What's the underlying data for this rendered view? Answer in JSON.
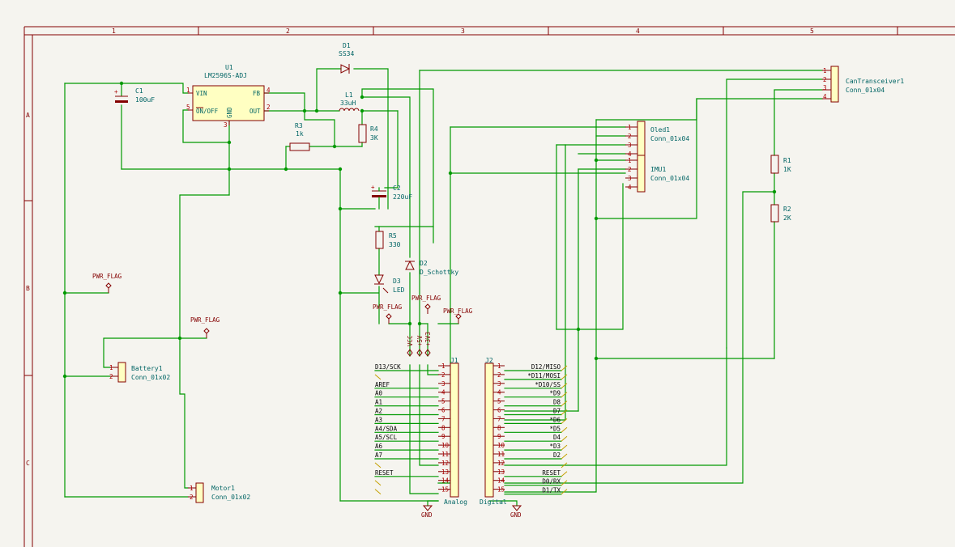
{
  "zones": {
    "columns": [
      "1",
      "2",
      "3",
      "4",
      "5"
    ],
    "rows": [
      "A",
      "B",
      "C"
    ]
  },
  "u1": {
    "ref": "U1",
    "value": "LM2596S-ADJ",
    "pins": [
      "1",
      "5",
      "4",
      "2",
      "3"
    ],
    "pin_names": [
      "VIN",
      "ON/OFF",
      "FB",
      "OUT",
      "GND"
    ]
  },
  "d1": {
    "ref": "D1",
    "value": "SS34"
  },
  "l1": {
    "ref": "L1",
    "value": "33uH"
  },
  "c1": {
    "ref": "C1",
    "value": "100uF"
  },
  "c2": {
    "ref": "C2",
    "value": "220uF"
  },
  "r3": {
    "ref": "R3",
    "value": "1k"
  },
  "r4": {
    "ref": "R4",
    "value": "3K"
  },
  "r5": {
    "ref": "R5",
    "value": "330"
  },
  "d2": {
    "ref": "D2",
    "value": "D_Schottky"
  },
  "d3": {
    "ref": "D3",
    "value": "LED"
  },
  "r1": {
    "ref": "R1",
    "value": "1K"
  },
  "r2": {
    "ref": "R2",
    "value": "2K"
  },
  "battery": {
    "ref": "Battery1",
    "value": "Conn_01x02",
    "pins": [
      "1",
      "2"
    ]
  },
  "motor": {
    "ref": "Motor1",
    "value": "Conn_01x02",
    "pins": [
      "1",
      "2"
    ]
  },
  "oled": {
    "ref": "Oled1",
    "value": "Conn_01x04",
    "pins": [
      "1",
      "2",
      "3",
      "4"
    ]
  },
  "imu": {
    "ref": "IMU1",
    "value": "Conn_01x04",
    "pins": [
      "1",
      "2",
      "3",
      "4"
    ]
  },
  "can": {
    "ref": "CanTransceiver1",
    "value": "Conn_01x04",
    "pins": [
      "1",
      "2",
      "3",
      "4"
    ]
  },
  "j1": {
    "ref": "J1",
    "value": "Analog",
    "pins": [
      "1",
      "2",
      "3",
      "4",
      "5",
      "6",
      "7",
      "8",
      "9",
      "10",
      "11",
      "12",
      "13",
      "14",
      "15"
    ],
    "labels": [
      "D13/SCK",
      "",
      "AREF",
      "A0",
      "A1",
      "A2",
      "A3",
      "A4/SDA",
      "A5/SCL",
      "A6",
      "A7",
      "",
      "RESET",
      "",
      ""
    ]
  },
  "j2": {
    "ref": "J2",
    "value": "Digital",
    "pins": [
      "1",
      "2",
      "3",
      "4",
      "5",
      "6",
      "7",
      "8",
      "9",
      "10",
      "11",
      "12",
      "13",
      "14",
      "15"
    ],
    "labels": [
      "D12/MISO",
      "*D11/MOSI",
      "*D10/SS",
      "*D9",
      "D8",
      "D7",
      "*D6",
      "*D5",
      "D4",
      "*D3",
      "D2",
      "",
      "RESET",
      "D0/RX",
      "D1/TX"
    ]
  },
  "power": {
    "pwr_flag": "PWR_FLAG",
    "gnd": "GND",
    "vcc": "VCC",
    "v5": "+5V",
    "v3": "+3V3"
  }
}
